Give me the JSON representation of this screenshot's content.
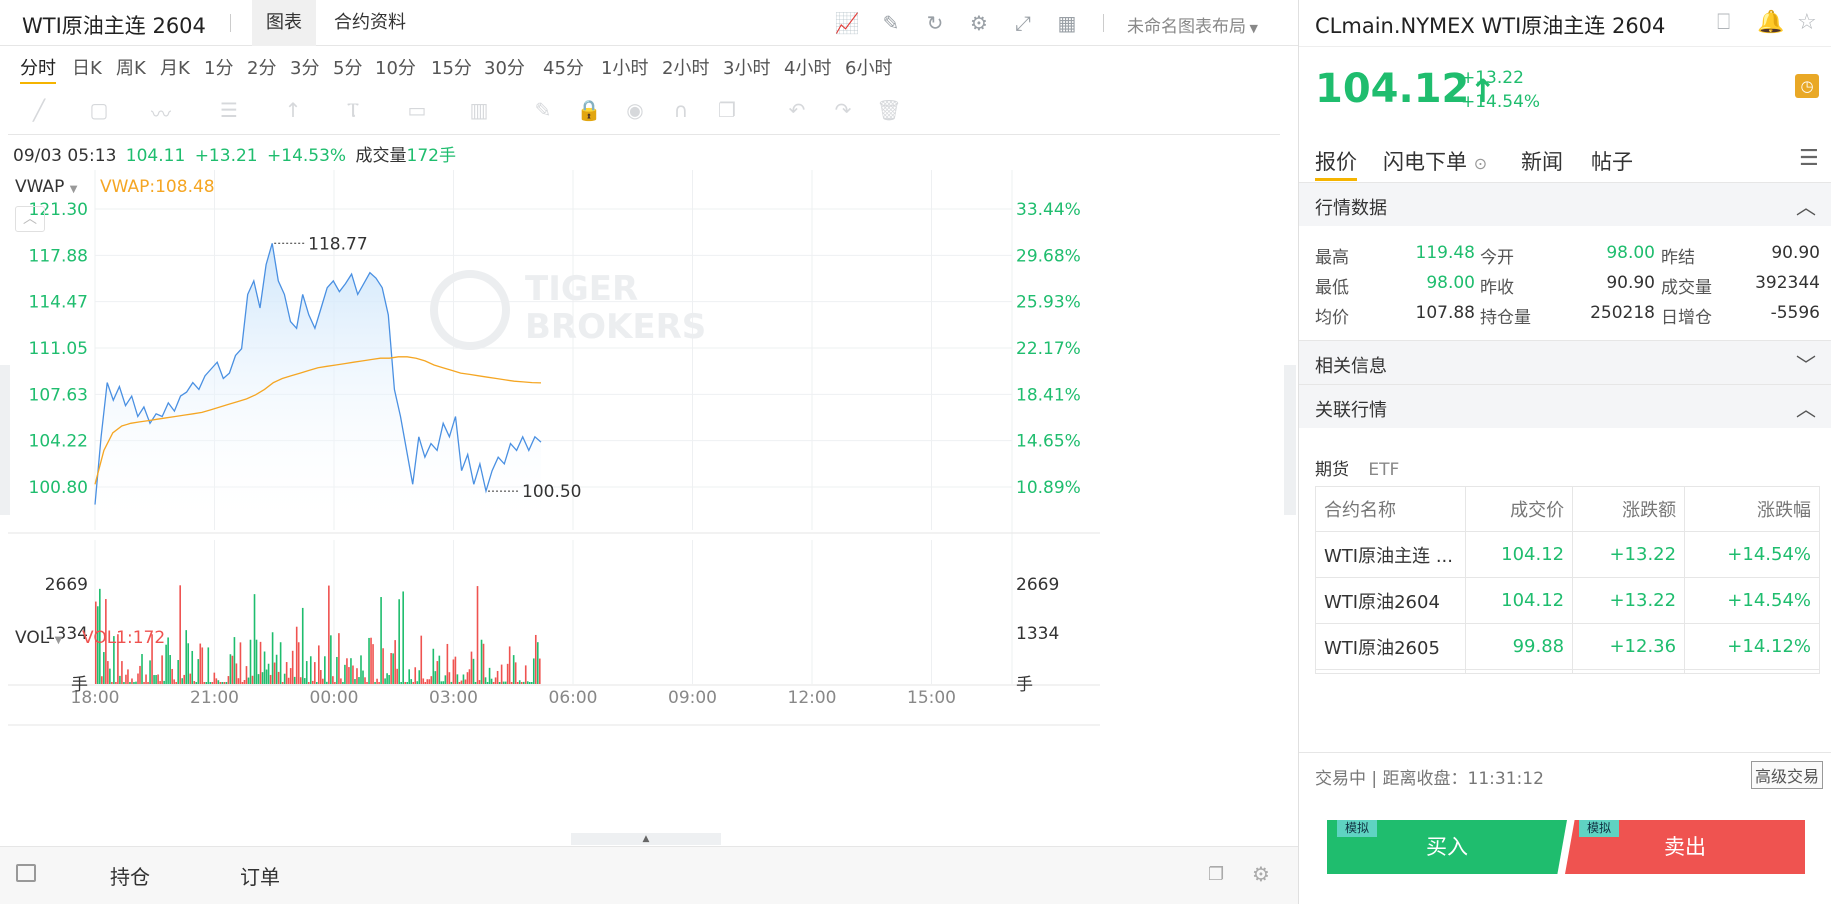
{
  "header": {
    "symbol_title": "WTI原油主连 2604",
    "tabs": [
      {
        "label": "图表"
      },
      {
        "label": "合约资料"
      }
    ],
    "layout_name": "未命名图表布局"
  },
  "periods": [
    "分时",
    "日K",
    "周K",
    "月K",
    "1分",
    "2分",
    "3分",
    "5分",
    "10分",
    "15分",
    "30分",
    "45分",
    "1小时",
    "2小时",
    "3小时",
    "4小时",
    "6小时"
  ],
  "info_line": {
    "datetime": "09/03 05:13",
    "price": "104.11",
    "change": "+13.21",
    "change_pct": "+14.53%",
    "vol_label": "成交量",
    "vol_value": "172手"
  },
  "indicators": {
    "main_name": "VWAP",
    "main_value": "VWAP:108.48",
    "vol_name": "VOL",
    "vol_value": "VOL1:172"
  },
  "watermark": [
    "TIGER",
    "BROKERS"
  ],
  "chart_data": {
    "type": "line",
    "title": "",
    "y_ticks_price": [
      "121.30",
      "117.88",
      "114.47",
      "111.05",
      "107.63",
      "104.22",
      "100.80"
    ],
    "y_ticks_pct": [
      "33.44%",
      "29.68%",
      "25.93%",
      "22.17%",
      "18.41%",
      "14.65%",
      "10.89%"
    ],
    "x_ticks": [
      "18:00",
      "21:00",
      "00:00",
      "03:00",
      "06:00",
      "09:00",
      "12:00",
      "15:00"
    ],
    "high_label": "118.77",
    "low_label": "100.50",
    "vol_ticks": [
      "2669",
      "1334"
    ],
    "vol_unit": "手",
    "ylim": [
      99.0,
      121.3
    ],
    "vol_max": 2669,
    "colors": {
      "price": "#4a90e2",
      "vwap": "#f5a623",
      "up": "#1fbd6e",
      "down": "#ef5350"
    },
    "series": [
      {
        "values": [
          99.5,
          104.5,
          108.5,
          107.2,
          108.2,
          106.8,
          107.5,
          106.0,
          106.7,
          105.5,
          106.2,
          106.0,
          107.0,
          106.4,
          107.5,
          107.8,
          108.5,
          108.0,
          109.0,
          109.5,
          110.0,
          108.8,
          109.2,
          110.5,
          111.0,
          115.0,
          116.0,
          114.0,
          117.2,
          118.77,
          116.0,
          115.0,
          113.0,
          112.5,
          115.0,
          113.5,
          112.5,
          114.0,
          115.5,
          116.0,
          115.2,
          115.8,
          116.5,
          115.0,
          115.8,
          116.6,
          116.2,
          115.5,
          113.5,
          108.0,
          106.0,
          103.5,
          101.0,
          104.5,
          103.0,
          104.0,
          103.5,
          105.5,
          104.5,
          106.0,
          102.0,
          103.2,
          101.0,
          102.5,
          100.5,
          102.0,
          103.0,
          102.5,
          104.0,
          103.5,
          104.5,
          103.5,
          104.5,
          104.11
        ]
      },
      {
        "values": [
          101.0,
          103.5,
          104.8,
          105.3,
          105.5,
          105.6,
          105.7,
          105.8,
          105.9,
          106.0,
          106.1,
          106.2,
          106.3,
          106.5,
          106.7,
          106.9,
          107.1,
          107.3,
          107.6,
          108.0,
          108.5,
          108.8,
          109.0,
          109.2,
          109.4,
          109.6,
          109.7,
          109.8,
          109.9,
          110.0,
          110.1,
          110.2,
          110.3,
          110.3,
          110.4,
          110.4,
          110.3,
          110.1,
          109.8,
          109.6,
          109.4,
          109.2,
          109.1,
          109.0,
          108.9,
          108.8,
          108.7,
          108.6,
          108.55,
          108.5,
          108.48
        ]
      }
    ]
  },
  "right_panel": {
    "title": "CLmain.NYMEX WTI原油主连 2604",
    "price": "104.12",
    "price_arrow": "↑",
    "change": "+13.22",
    "change_pct": "+14.54%",
    "tabs": [
      {
        "label": "报价"
      },
      {
        "label": "闪电下单"
      },
      {
        "label": "新闻"
      },
      {
        "label": "帖子"
      }
    ],
    "sections": {
      "quote": "行情数据",
      "related_info": "相关信息",
      "related_market": "关联行情"
    },
    "quote": {
      "high_label": "最高",
      "high": "119.48",
      "open_label": "今开",
      "open": "98.00",
      "settle_label": "昨结",
      "settle": "90.90",
      "low_label": "最低",
      "low": "98.00",
      "prev_close_label": "昨收",
      "prev_close": "90.90",
      "volume_label": "成交量",
      "volume": "392344",
      "avg_label": "均价",
      "avg": "107.88",
      "oi_label": "持仓量",
      "oi": "250218",
      "oi_chg_label": "日增仓",
      "oi_chg": "-5596"
    },
    "sub_tabs": [
      "期货",
      "ETF"
    ],
    "table": {
      "headers": [
        "合约名称",
        "成交价",
        "涨跌额",
        "涨跌幅"
      ],
      "rows": [
        [
          "WTI原油主连 ...",
          "104.12",
          "+13.22",
          "+14.54%"
        ],
        [
          "WTI原油2604",
          "104.12",
          "+13.22",
          "+14.54%"
        ],
        [
          "WTI原油2605",
          "99.88",
          "+12.36",
          "+14.12%"
        ]
      ]
    },
    "status": "交易中 | 距离收盘：11:31:12",
    "advanced": "高级交易",
    "buy": "买入",
    "sell": "卖出",
    "mock": "模拟"
  },
  "bottom": {
    "positions": "持仓",
    "orders": "订单"
  }
}
